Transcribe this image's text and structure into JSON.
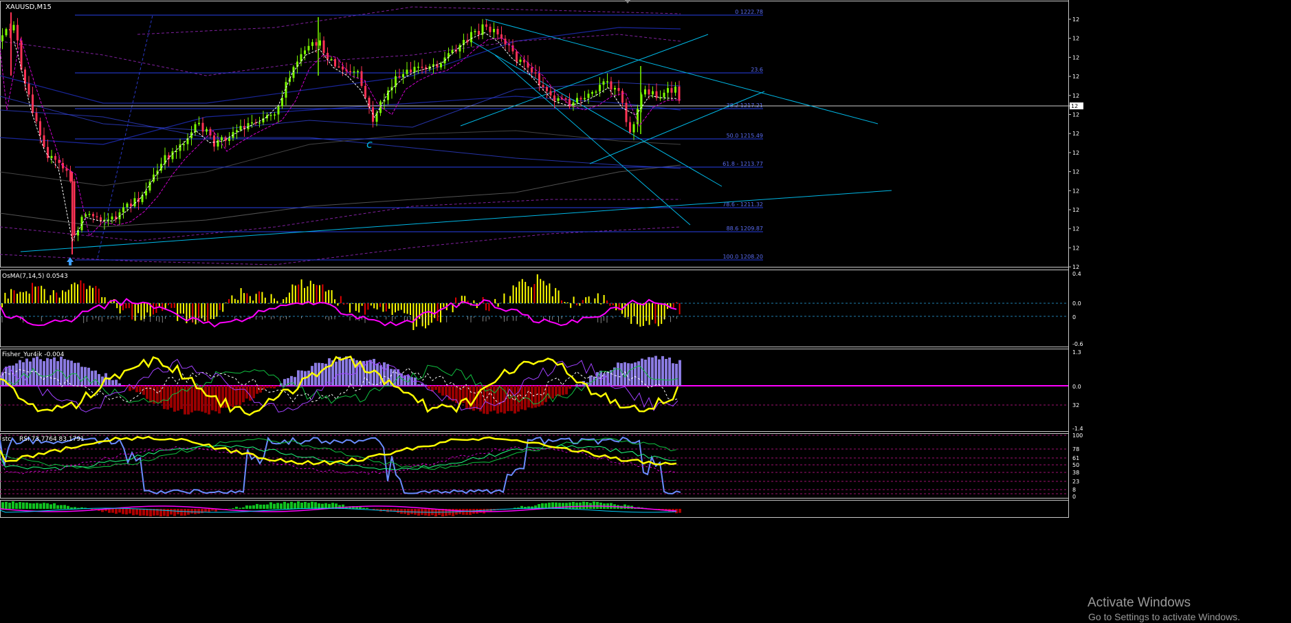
{
  "window": {
    "symbol_title": "XAUUSD,M15",
    "scale_mark": "12",
    "colors": {
      "bull": "#7CFC00",
      "bear": "#FF3355",
      "fib": "#3A4FE0",
      "trend": "#00B8E6",
      "osma_pos": "#FFFF00",
      "osma_neg": "#E00000",
      "fisher_hist_pos": "#8A7AE0",
      "fisher_hist_neg": "#990000",
      "fisher_line": "#FFFF00",
      "zero_line": "#FF00FF",
      "rsi_blue": "#6A8CFF"
    }
  },
  "chart_data": [
    {
      "type": "candlestick",
      "title": "XAUUSD,M15",
      "fib_levels": [
        {
          "level": 0,
          "label": "0 1222.78"
        },
        {
          "level": 23.6,
          "label": "23.6"
        },
        {
          "level": 38.2,
          "label": "38.2 1217.21"
        },
        {
          "level": 50.0,
          "label": "50.0 1215.49"
        },
        {
          "level": 61.8,
          "label": "61.8 - 1213.77"
        },
        {
          "level": 78.6,
          "label": "78.6 - 1211.32"
        },
        {
          "level": 88.6,
          "label": "88.6 1209.87"
        },
        {
          "level": 100.0,
          "label": "100.0 1208.20"
        }
      ],
      "wave_label": "c",
      "y_tick_labels": [
        "12",
        "12",
        "12",
        "12",
        "12",
        "12",
        "12",
        "12",
        "12",
        "12",
        "12",
        "12",
        "12",
        "12"
      ]
    },
    {
      "type": "bar",
      "title": "OsMA(7,14,5) 0.0543",
      "y_tick_labels": [
        "0.4",
        "0.0",
        "0",
        "-0.6"
      ]
    },
    {
      "type": "bar",
      "title": "Fisher_Yur4ik -0.004",
      "y_tick_labels": [
        "1.3",
        "0.0",
        "32",
        "-1.4"
      ]
    },
    {
      "type": "line",
      "title": "RSI 73.7764 83.1791",
      "title_prefix": "stc",
      "y_tick_labels": [
        "100",
        "78",
        "61",
        "50",
        "38",
        "23",
        "8",
        "0"
      ]
    },
    {
      "type": "bar",
      "title": "",
      "y_tick_labels": []
    }
  ],
  "watermark": {
    "line1": "Activate Windows",
    "line2": "Go to Settings to activate Windows."
  }
}
